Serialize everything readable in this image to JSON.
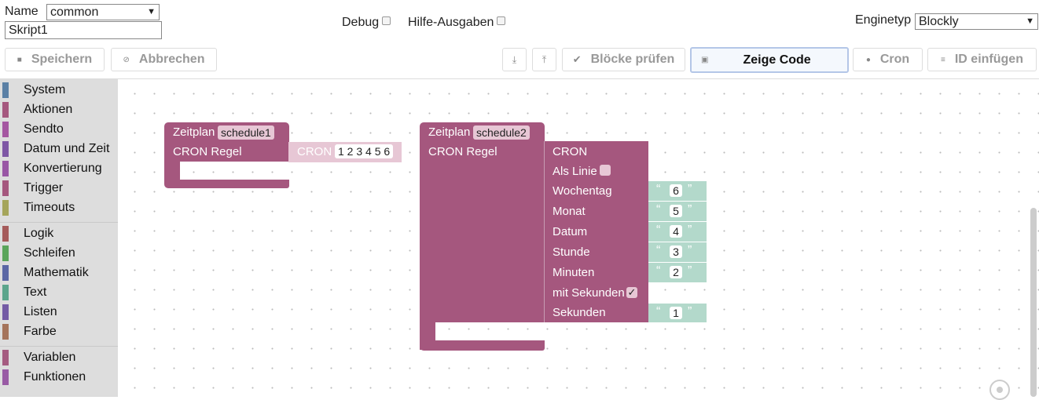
{
  "header": {
    "name_label": "Name",
    "name_value": "common",
    "script_name": "Skript1",
    "debug_label": "Debug",
    "help_label": "Hilfe-Ausgaben",
    "engine_label": "Enginetyp",
    "engine_value": "Blockly"
  },
  "toolbar": {
    "save": "Speichern",
    "cancel": "Abbrechen",
    "check": "Blöcke prüfen",
    "show_code": "Zeige Code",
    "cron": "Cron",
    "insert_id": "ID einfügen"
  },
  "sidebar": {
    "groups": [
      [
        {
          "label": "System",
          "color": "#5b80a5"
        },
        {
          "label": "Aktionen",
          "color": "#a5577e"
        },
        {
          "label": "Sendto",
          "color": "#a557a1"
        },
        {
          "label": "Datum und Zeit",
          "color": "#7e57a5"
        },
        {
          "label": "Konvertierung",
          "color": "#9957a5"
        },
        {
          "label": "Trigger",
          "color": "#a5577e"
        },
        {
          "label": "Timeouts",
          "color": "#a5a55b"
        }
      ],
      [
        {
          "label": "Logik",
          "color": "#a55b5b"
        },
        {
          "label": "Schleifen",
          "color": "#5ba55b"
        },
        {
          "label": "Mathematik",
          "color": "#5b67a5"
        },
        {
          "label": "Text",
          "color": "#5ba58c"
        },
        {
          "label": "Listen",
          "color": "#745ba5"
        },
        {
          "label": "Farbe",
          "color": "#a5745b"
        }
      ],
      [
        {
          "label": "Variablen",
          "color": "#a55b80"
        },
        {
          "label": "Funktionen",
          "color": "#995ba5"
        }
      ]
    ]
  },
  "blocks": {
    "block1": {
      "title": "Zeitplan",
      "schedule": "schedule1",
      "rule_label": "CRON Regel",
      "cron_label": "CRON",
      "cron_value": "1 2 3 4 5 6"
    },
    "block2": {
      "title": "Zeitplan",
      "schedule": "schedule2",
      "rule_label": "CRON Regel",
      "cron_label": "CRON",
      "line_label": "Als Linie",
      "inputs": [
        {
          "label": "Wochentag",
          "value": "6"
        },
        {
          "label": "Monat",
          "value": "5"
        },
        {
          "label": "Datum",
          "value": "4"
        },
        {
          "label": "Stunde",
          "value": "3"
        },
        {
          "label": "Minuten",
          "value": "2"
        }
      ],
      "seconds_flag_label": "mit Sekunden",
      "seconds_label": "Sekunden",
      "seconds_value": "1",
      "check_mark": "✓"
    },
    "quote_open": "“",
    "quote_close": "”"
  }
}
